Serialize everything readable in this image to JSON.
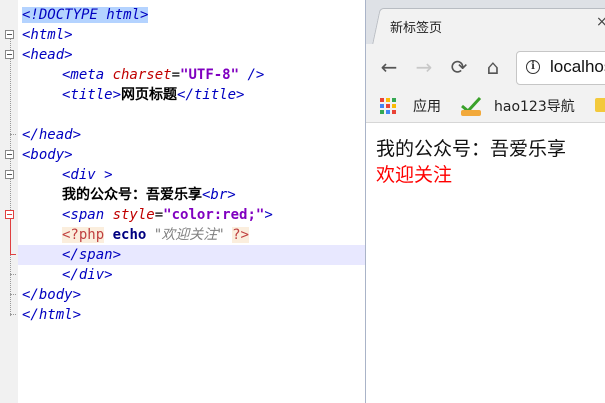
{
  "editor": {
    "doctype": "<!DOCTYPE html>",
    "html_open": "<html>",
    "head_open": "<head>",
    "meta_open": "<meta ",
    "meta_attr": "charset",
    "meta_eq": "=",
    "meta_value": "\"UTF-8\"",
    "meta_close": " />",
    "title_open": "<title>",
    "title_text": "网页标题",
    "title_close": "</title>",
    "head_close": "</head>",
    "body_open": "<body>",
    "div_open": "<div >",
    "line_text": "我的公众号：吾爱乐享",
    "br_tag": "<br>",
    "span_open": "<span ",
    "span_attr": "style",
    "span_eq": "=",
    "span_value": "\"color:red;\"",
    "span_gt": ">",
    "php_open": "<?php",
    "php_echo": "echo",
    "php_string": "\"欢迎关注\"",
    "php_close": "?>",
    "span_close": "</span>",
    "div_close": "</div>",
    "body_close": "</body>",
    "html_close": "</html>"
  },
  "browser": {
    "tab_title": "新标签页",
    "tab_close": "×",
    "back_icon": "←",
    "forward_icon": "→",
    "reload_icon": "⟳",
    "home_icon": "⌂",
    "url": "localhost",
    "info_icon": "i",
    "bookmarks": [
      {
        "label": "应用"
      },
      {
        "label": "hao123导航"
      }
    ],
    "page": {
      "line1": "我的公众号：吾爱乐享",
      "line2": "欢迎关注"
    }
  },
  "colors": {
    "tag": "#0000c0",
    "attribute": "#c00000",
    "value": "#8000c0",
    "red_text": "#ff0000"
  }
}
